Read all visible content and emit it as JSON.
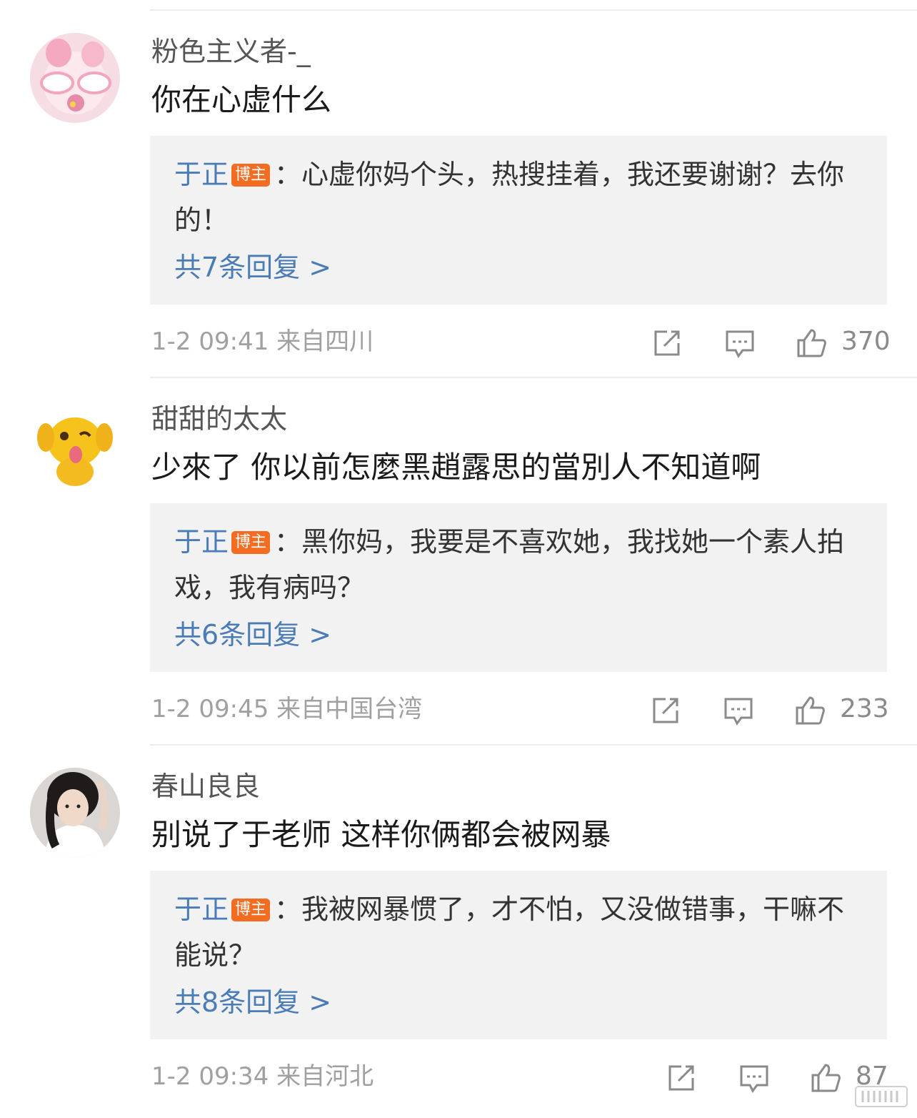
{
  "comments": [
    {
      "username": "粉色主义者-_",
      "text": "你在心虚什么",
      "avatar_icon": "pink-toy-avatar",
      "reply": {
        "author": "于正",
        "badge": "博主",
        "text": "：心虚你妈个头，热搜挂着，我还要谢谢？去你的！",
        "more": "共7条回复 >"
      },
      "meta": "1-2 09:41 来自四川",
      "likes": "370"
    },
    {
      "username": "甜甜的太太",
      "text": "少來了 你以前怎麼黑趙露思的當別人不知道啊",
      "avatar_icon": "yellow-cartoon-avatar",
      "reply": {
        "author": "于正",
        "badge": "博主",
        "text": "：黑你妈，我要是不喜欢她，我找她一个素人拍戏，我有病吗？",
        "more": "共6条回复 >"
      },
      "meta": "1-2 09:45 来自中国台湾",
      "likes": "233"
    },
    {
      "username": "春山良良",
      "text": "别说了于老师 这样你俩都会被网暴",
      "avatar_icon": "girl-photo-avatar",
      "reply": {
        "author": "于正",
        "badge": "博主",
        "text": "：我被网暴惯了，才不怕，又没做错事，干嘛不能说？",
        "more": "共8条回复 >"
      },
      "meta": "1-2 09:34 来自河北",
      "likes": "87"
    }
  ],
  "colors": {
    "link_blue": "#4a7cb8",
    "badge_orange": "#f26c21",
    "reply_bg": "#f2f2f2",
    "meta_gray": "#a0a0a0"
  }
}
